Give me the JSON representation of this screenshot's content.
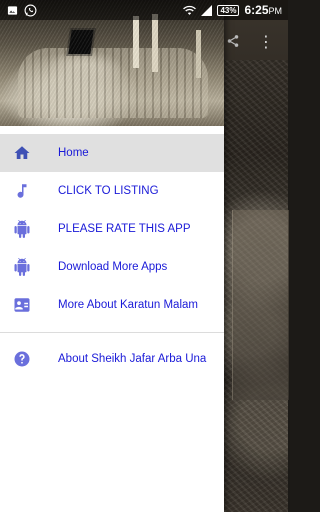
{
  "status_bar": {
    "battery": "43%",
    "time": "6:25",
    "time_suffix": "PM"
  },
  "toolbar": {
    "share_icon": "share-icon",
    "more_icon": "more-vert-icon",
    "more_glyph": "⋮"
  },
  "drawer": {
    "items": [
      {
        "label": "Home",
        "icon": "home-icon",
        "active": true
      },
      {
        "label": "CLICK TO LISTING",
        "icon": "music-note-icon"
      },
      {
        "label": "PLEASE RATE THIS APP",
        "icon": "android-icon"
      },
      {
        "label": "Download More Apps",
        "icon": "android-icon"
      },
      {
        "label": "More About Karatun Malam",
        "icon": "contact-card-icon"
      }
    ],
    "secondary_items": [
      {
        "label": "About Sheikh Jafar Arba Una",
        "icon": "help-icon"
      }
    ]
  },
  "colors": {
    "accent_text": "#1a1ad8",
    "icon_color": "#3f51b5",
    "active_bg": "#e0e0e0"
  }
}
